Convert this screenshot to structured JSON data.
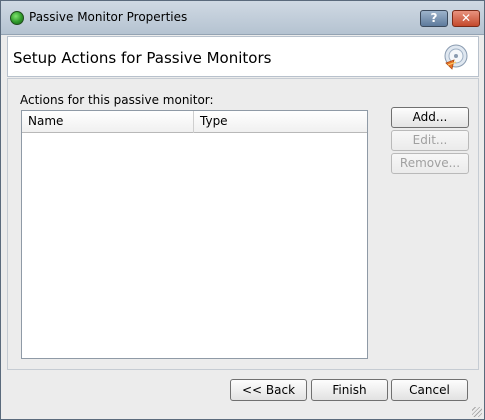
{
  "window": {
    "title": "Passive Monitor Properties",
    "help_label": "?",
    "close_label": "✕"
  },
  "header": {
    "title": "Setup Actions for Passive Monitors"
  },
  "actions": {
    "label": "Actions for this passive monitor:",
    "columns": [
      "Name",
      "Type"
    ],
    "rows": []
  },
  "buttons": {
    "add": "Add...",
    "edit": "Edit...",
    "remove": "Remove...",
    "back": "<< Back",
    "finish": "Finish",
    "cancel": "Cancel"
  },
  "colors": {
    "accent": "#5e7b9c",
    "close": "#c44a2c"
  }
}
